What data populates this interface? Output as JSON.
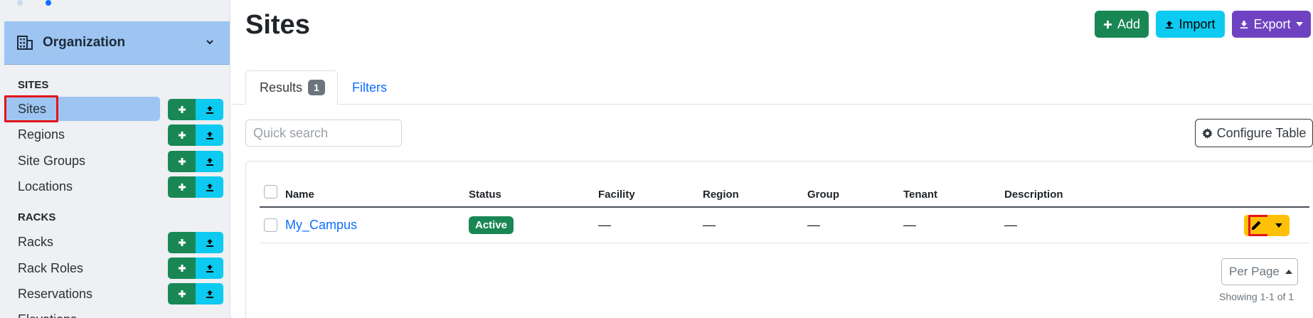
{
  "colors": {
    "accent_green": "#198754",
    "accent_cyan": "#0dcaf0",
    "accent_purple": "#6f42c1",
    "sidebar_active": "#9ec5f2",
    "warning": "#ffc107",
    "highlight": "#e3141b"
  },
  "sidebar": {
    "menu_label": "Organization",
    "menu_icon": "building-icon",
    "sections": [
      {
        "title": "SITES"
      },
      {
        "title": "RACKS"
      }
    ],
    "items": [
      {
        "label": "Sites",
        "active": true
      },
      {
        "label": "Regions"
      },
      {
        "label": "Site Groups"
      },
      {
        "label": "Locations"
      },
      {
        "label": "Racks"
      },
      {
        "label": "Rack Roles"
      },
      {
        "label": "Reservations"
      },
      {
        "label": "Elevations"
      }
    ]
  },
  "header": {
    "title": "Sites",
    "add_label": "Add",
    "import_label": "Import",
    "export_label": "Export"
  },
  "tabs": {
    "results_label": "Results",
    "results_count": "1",
    "filters_label": "Filters"
  },
  "search": {
    "placeholder": "Quick search"
  },
  "configure_label": "Configure Table",
  "table": {
    "columns": [
      "Name",
      "Status",
      "Facility",
      "Region",
      "Group",
      "Tenant",
      "Description"
    ],
    "rows": [
      {
        "name": "My_Campus",
        "status": "Active",
        "facility": "—",
        "region": "—",
        "group": "—",
        "tenant": "—",
        "description": "—"
      }
    ]
  },
  "pagination": {
    "per_page_label": "Per Page",
    "showing": "Showing 1-1 of 1"
  }
}
